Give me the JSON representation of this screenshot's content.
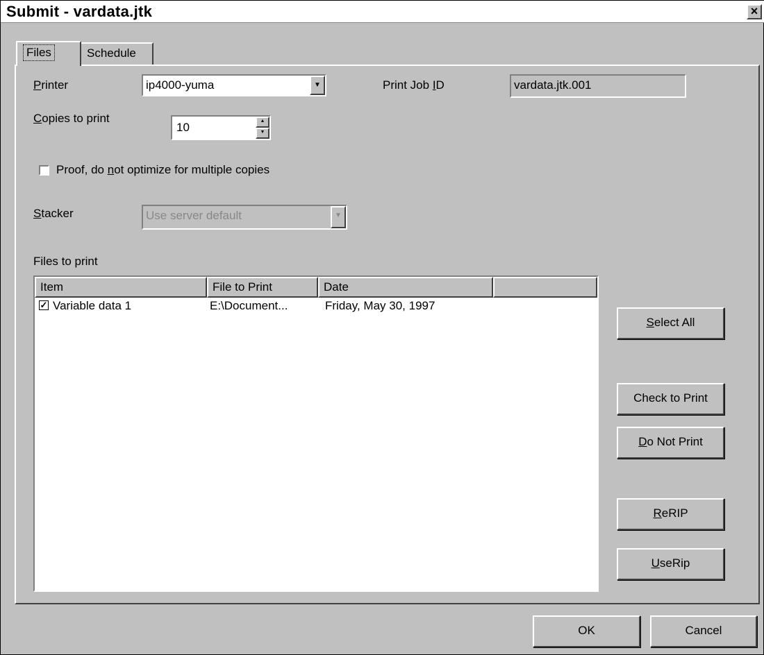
{
  "window": {
    "title": "Submit - vardata.jtk",
    "close_glyph": "×"
  },
  "tabs": [
    {
      "label": "Files",
      "active": true
    },
    {
      "label": "Schedule",
      "active": false
    }
  ],
  "printer": {
    "label_key": "P",
    "label_rest": "rinter",
    "value": "ip4000-yuma"
  },
  "print_job_id": {
    "label_pre": "Print Job ",
    "label_key": "I",
    "label_post": "D",
    "value": "vardata.jtk.001"
  },
  "copies": {
    "label_key": "C",
    "label_rest": "opies to print",
    "value": "10"
  },
  "proof": {
    "label_pre": "Proof,  do ",
    "label_key": "n",
    "label_post": "ot optimize for multiple copies",
    "checked": false
  },
  "stacker": {
    "label_key": "S",
    "label_rest": "tacker",
    "value": "Use server default",
    "disabled": true
  },
  "files_to_print": {
    "label": "Files to print",
    "columns": [
      "Item",
      "File to Print",
      "Date",
      ""
    ],
    "rows": [
      {
        "checked": true,
        "item": "Variable data 1",
        "file": "E:\\Document...",
        "date": "Friday, May 30, 1997"
      }
    ]
  },
  "side_buttons": {
    "select_all": {
      "key": "S",
      "rest": "elect All"
    },
    "check_to_print": {
      "label": "Check to Print"
    },
    "do_not_print": {
      "key": "D",
      "rest": "o Not Print"
    },
    "rerip": {
      "key": "R",
      "rest": "eRIP"
    },
    "userip": {
      "key": "U",
      "rest": "seRip"
    }
  },
  "footer": {
    "ok": "OK",
    "cancel": "Cancel"
  }
}
